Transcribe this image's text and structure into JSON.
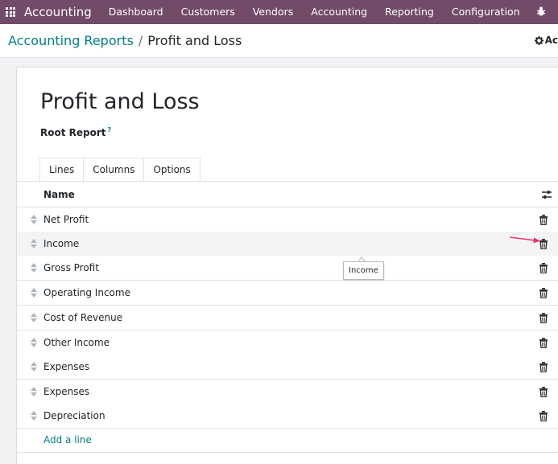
{
  "navbar": {
    "brand": "Accounting",
    "menu": [
      "Dashboard",
      "Customers",
      "Vendors",
      "Accounting",
      "Reporting",
      "Configuration"
    ],
    "icons": [
      "apps-icon",
      "bug-icon"
    ],
    "color": "#714b67"
  },
  "control_panel": {
    "breadcrumb_parent": "Accounting Reports",
    "breadcrumb_separator": "/",
    "breadcrumb_current": "Profit and Loss",
    "action_label": "Ac",
    "action_icon": "gear-icon"
  },
  "form": {
    "title": "Profit and Loss",
    "root_report_label": "Root Report",
    "root_report_help": "?",
    "tabs": [
      "Lines",
      "Columns",
      "Options"
    ],
    "active_tab": "Lines"
  },
  "table": {
    "column_name": "Name",
    "rows": [
      {
        "label": "Net Profit"
      },
      {
        "label": "Income"
      },
      {
        "label": "Gross Profit"
      },
      {
        "label": "Operating Income"
      },
      {
        "label": "Cost of Revenue"
      },
      {
        "label": "Other Income"
      },
      {
        "label": "Expenses"
      },
      {
        "label": "Expenses"
      },
      {
        "label": "Depreciation"
      }
    ],
    "add_line": "Add a line",
    "row_icons": [
      "drag-handle-icon",
      "trash-icon"
    ]
  },
  "tooltip": {
    "text": "Income"
  },
  "colors": {
    "accent": "#017e84",
    "annotation_arrow": "#e8336d"
  }
}
